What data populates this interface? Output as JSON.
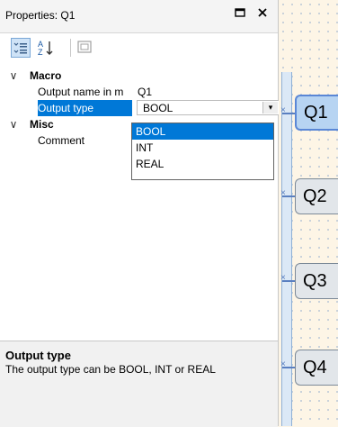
{
  "panel": {
    "title": "Properties: Q1",
    "maximize_glyph": "🗖",
    "close_glyph": "✕"
  },
  "toolbar": {
    "categorized_icon": "categorized-icon",
    "alphabetical_icon": "sort-az-icon",
    "pages_icon": "property-pages-icon"
  },
  "grid": {
    "categories": [
      {
        "label": "Macro",
        "expanded_glyph": "∨",
        "properties": [
          {
            "name": "Output name in m",
            "value": "Q1"
          },
          {
            "name": "Output type",
            "value": "BOOL"
          }
        ]
      },
      {
        "label": "Misc",
        "expanded_glyph": "∨",
        "properties": [
          {
            "name": "Comment",
            "value": ""
          }
        ]
      }
    ]
  },
  "dropdown": {
    "options": [
      "BOOL",
      "INT",
      "REAL"
    ],
    "selected": "BOOL"
  },
  "description": {
    "heading": "Output type",
    "text": "The output type can be BOOL, INT or REAL"
  },
  "canvas": {
    "outputs": [
      "Q1",
      "Q2",
      "Q3",
      "Q4"
    ],
    "active": "Q1"
  },
  "colors": {
    "selection": "#0078d7",
    "canvas_bg": "#fdf5e6",
    "block_active": "#b7d4f2"
  }
}
